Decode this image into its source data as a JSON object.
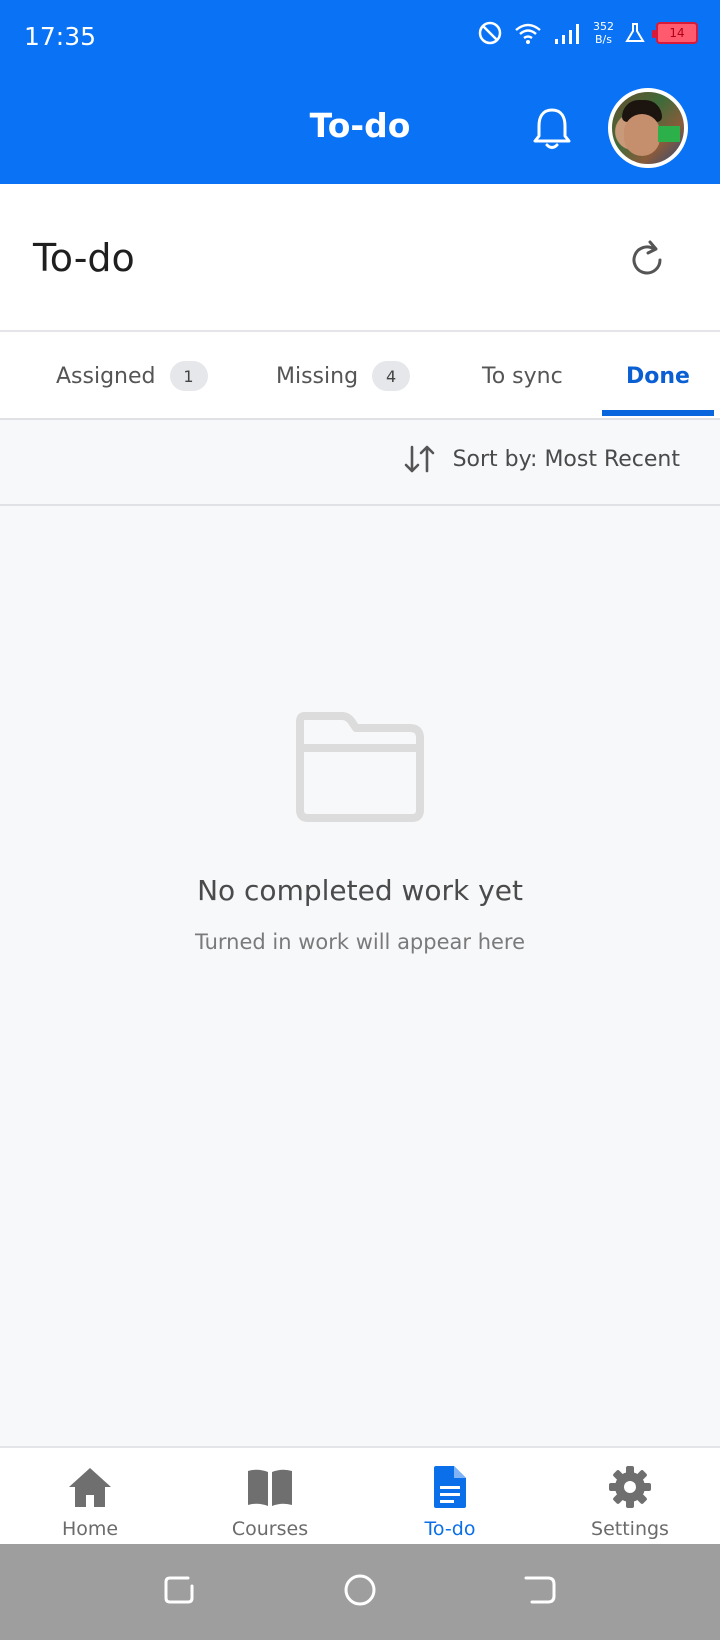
{
  "status_bar": {
    "time": "17:35",
    "net_speed_value": "352",
    "net_speed_unit": "B/s",
    "battery": "14"
  },
  "app_bar": {
    "title": "To-do",
    "icons": [
      "bell-icon",
      "avatar"
    ]
  },
  "page": {
    "title": "To-do",
    "refresh_icon": "refresh-icon"
  },
  "tabs": [
    {
      "label": "Assigned",
      "badge": "1"
    },
    {
      "label": "Missing",
      "badge": "4"
    },
    {
      "label": "To sync"
    },
    {
      "label": "Done",
      "selected": true
    }
  ],
  "sort": {
    "label": "Sort by: Most Recent",
    "icon": "sort-icon"
  },
  "empty_state": {
    "icon": "folder-icon",
    "title": "No completed work yet",
    "subtitle": "Turned in work will appear here"
  },
  "bottom_nav": {
    "items": [
      {
        "label": "Home",
        "icon": "home-icon"
      },
      {
        "label": "Courses",
        "icon": "book-icon"
      },
      {
        "label": "To-do",
        "icon": "document-icon",
        "active": true
      },
      {
        "label": "Settings",
        "icon": "gear-icon"
      }
    ]
  },
  "colors": {
    "primary": "#0a73f5",
    "active_tab": "#0a5fd3",
    "background": "#f7f8fa"
  }
}
